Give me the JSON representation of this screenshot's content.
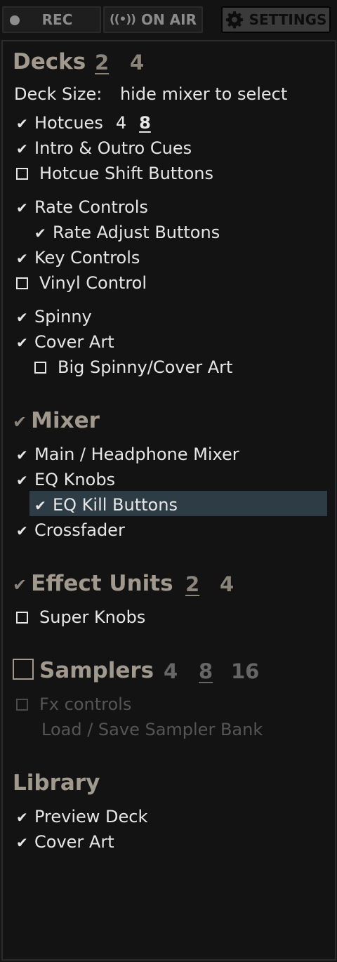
{
  "topbar": {
    "rec_label": "REC",
    "onair_label": "ON AIR",
    "onair_icon": "((•))",
    "settings_label": "SETTINGS"
  },
  "decks": {
    "title": "Decks",
    "counts": [
      "2",
      "4"
    ],
    "selected_count": "2",
    "deck_size_label": "Deck Size:",
    "deck_size_value": "hide mixer to select",
    "hotcues": {
      "label": "Hotcues",
      "checked": true,
      "options": [
        "4",
        "8"
      ],
      "selected": "8"
    },
    "intro_outro": {
      "label": "Intro & Outro Cues",
      "checked": true
    },
    "hotcue_shift": {
      "label": "Hotcue Shift Buttons",
      "checked": false
    },
    "rate_controls": {
      "label": "Rate Controls",
      "checked": true
    },
    "rate_adjust": {
      "label": "Rate Adjust Buttons",
      "checked": true
    },
    "key_controls": {
      "label": "Key Controls",
      "checked": true
    },
    "vinyl_control": {
      "label": "Vinyl Control",
      "checked": false
    },
    "spinny": {
      "label": "Spinny",
      "checked": true
    },
    "cover_art": {
      "label": "Cover Art",
      "checked": true
    },
    "big_spinny": {
      "label": "Big Spinny/Cover Art",
      "checked": false
    }
  },
  "mixer": {
    "title": "Mixer",
    "checked": true,
    "main_headphone": {
      "label": "Main / Headphone Mixer",
      "checked": true
    },
    "eq_knobs": {
      "label": "EQ Knobs",
      "checked": true
    },
    "eq_kill": {
      "label": "EQ Kill Buttons",
      "checked": true
    },
    "crossfader": {
      "label": "Crossfader",
      "checked": true
    }
  },
  "effects": {
    "title": "Effect Units",
    "checked": true,
    "counts": [
      "2",
      "4"
    ],
    "selected_count": "2",
    "super_knobs": {
      "label": "Super Knobs",
      "checked": false
    }
  },
  "samplers": {
    "title": "Samplers",
    "checked": false,
    "counts": [
      "4",
      "8",
      "16"
    ],
    "selected_count": "8",
    "fx_controls": {
      "label": "Fx controls",
      "checked": false
    },
    "load_save": {
      "label": "Load / Save Sampler Bank"
    }
  },
  "library": {
    "title": "Library",
    "preview_deck": {
      "label": "Preview Deck",
      "checked": true
    },
    "cover_art": {
      "label": "Cover Art",
      "checked": true
    }
  },
  "check_glyph": "✔",
  "colors": {
    "background": "#131313",
    "section_title": "#a1998e",
    "text": "#e6e6e6",
    "highlight": "#2e3c46",
    "disabled": "#555555"
  }
}
